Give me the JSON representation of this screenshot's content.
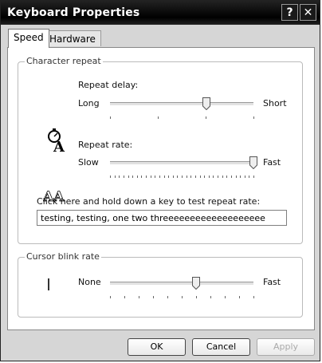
{
  "window": {
    "title": "Keyboard Properties",
    "help_label": "?",
    "close_label": "✕"
  },
  "tabs": [
    {
      "label": "Speed",
      "active": true
    },
    {
      "label": "Hardware",
      "active": false
    }
  ],
  "character_repeat": {
    "group_label": "Character repeat",
    "repeat_delay": {
      "label": "Repeat delay:",
      "left_label": "Long",
      "right_label": "Short",
      "level_fraction": 0.67,
      "tick_count": 4
    },
    "repeat_rate": {
      "label": "Repeat rate:",
      "left_label": "Slow",
      "right_label": "Fast",
      "level_fraction": 1.0,
      "tick_count": 33
    },
    "test": {
      "prompt": "Click here and hold down a key to test repeat rate:",
      "value": "testing, testing, one two threeeeeeeeeeeeeeeeeee"
    }
  },
  "cursor_blink": {
    "group_label": "Cursor blink rate",
    "left_label": "None",
    "right_label": "Fast",
    "level_fraction": 0.6,
    "tick_count": 11,
    "icon": "text-cursor-icon"
  },
  "buttons": {
    "ok": "OK",
    "cancel": "Cancel",
    "apply": "Apply"
  },
  "colors": {
    "titlebar": "#000000",
    "window_bg": "#d6d6d6",
    "panel_bg": "#ffffff"
  }
}
